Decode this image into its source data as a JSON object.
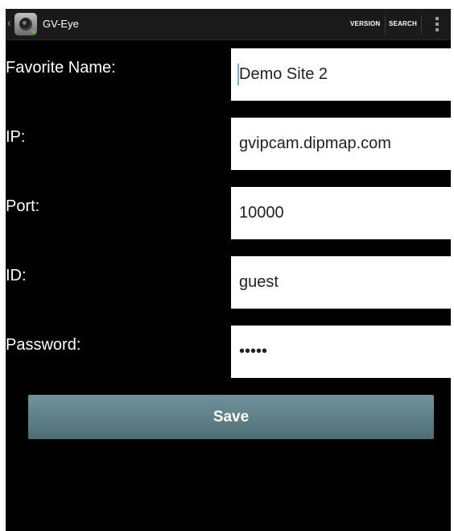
{
  "actionbar": {
    "title": "GV-Eye",
    "version_label": "VERSION",
    "search_label": "SEARCH"
  },
  "form": {
    "favorite_name": {
      "label": "Favorite Name:",
      "value": "Demo Site 2"
    },
    "ip": {
      "label": "IP:",
      "value": "gvipcam.dipmap.com"
    },
    "port": {
      "label": "Port:",
      "value": "10000"
    },
    "id": {
      "label": "ID:",
      "value": "guest"
    },
    "password": {
      "label": "Password:",
      "value": "•••••"
    }
  },
  "save_label": "Save",
  "colors": {
    "screen_bg": "#000000",
    "actionbar_bg": "#1a1a1a",
    "field_bg": "#ffffff",
    "button_top": "#6f939a",
    "button_bottom": "#4e6e75",
    "cursor": "#6fb6e8"
  },
  "icons": [
    "back-caret-icon",
    "gv-eye-app-icon",
    "overflow-menu-icon"
  ]
}
